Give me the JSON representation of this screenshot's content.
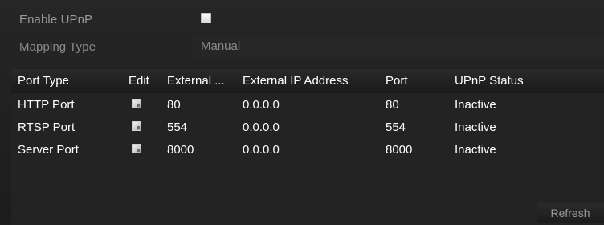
{
  "upnp": {
    "enable_label": "Enable UPnP",
    "enabled": false,
    "mapping_type_label": "Mapping Type",
    "mapping_type_value": "Manual"
  },
  "table": {
    "headers": [
      "Port Type",
      "Edit",
      "External ...",
      "External IP Address",
      "Port",
      "UPnP Status"
    ],
    "rows": [
      {
        "port_type": "HTTP Port",
        "external_port": "80",
        "external_ip": "0.0.0.0",
        "port": "80",
        "status": "Inactive"
      },
      {
        "port_type": "RTSP Port",
        "external_port": "554",
        "external_ip": "0.0.0.0",
        "port": "554",
        "status": "Inactive"
      },
      {
        "port_type": "Server Port",
        "external_port": "8000",
        "external_ip": "0.0.0.0",
        "port": "8000",
        "status": "Inactive"
      }
    ]
  },
  "buttons": {
    "refresh_label": "Refresh"
  }
}
